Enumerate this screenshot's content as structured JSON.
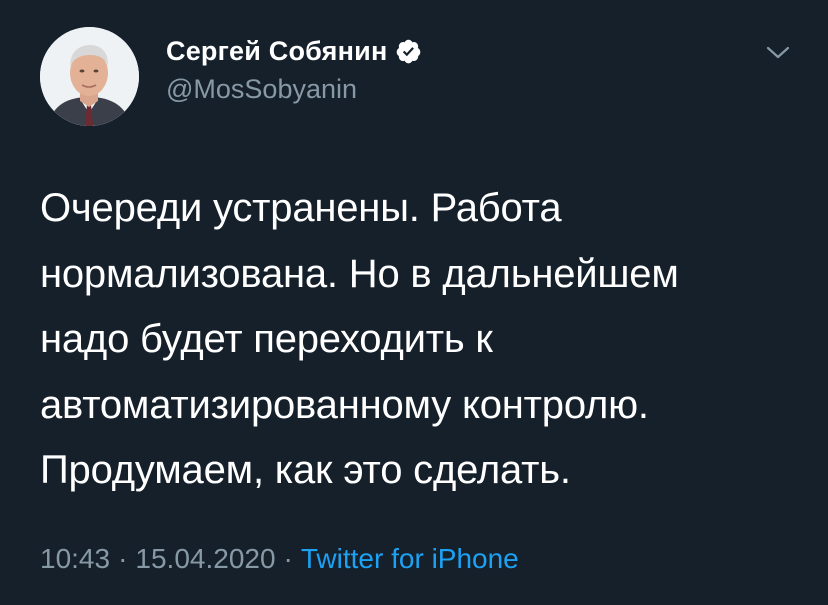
{
  "author": {
    "display_name": "Сергей Собянин",
    "handle": "@MosSobyanin",
    "verified": true,
    "avatar_icon": "portrait-avatar"
  },
  "menu": {
    "icon": "chevron-down-icon"
  },
  "tweet": {
    "lines": [
      "Очереди устранены. Работа",
      "нормализована. Но в дальнейшем",
      "надо будет переходить к",
      "автоматизированному контролю.",
      "Продумаем, как это сделать."
    ]
  },
  "meta": {
    "time": "10:43",
    "separator": "·",
    "date": "15.04.2020",
    "source": "Twitter for iPhone"
  },
  "colors": {
    "background": "#15202b",
    "text": "#ffffff",
    "secondary": "#8899a6",
    "accent": "#1da1f2"
  }
}
